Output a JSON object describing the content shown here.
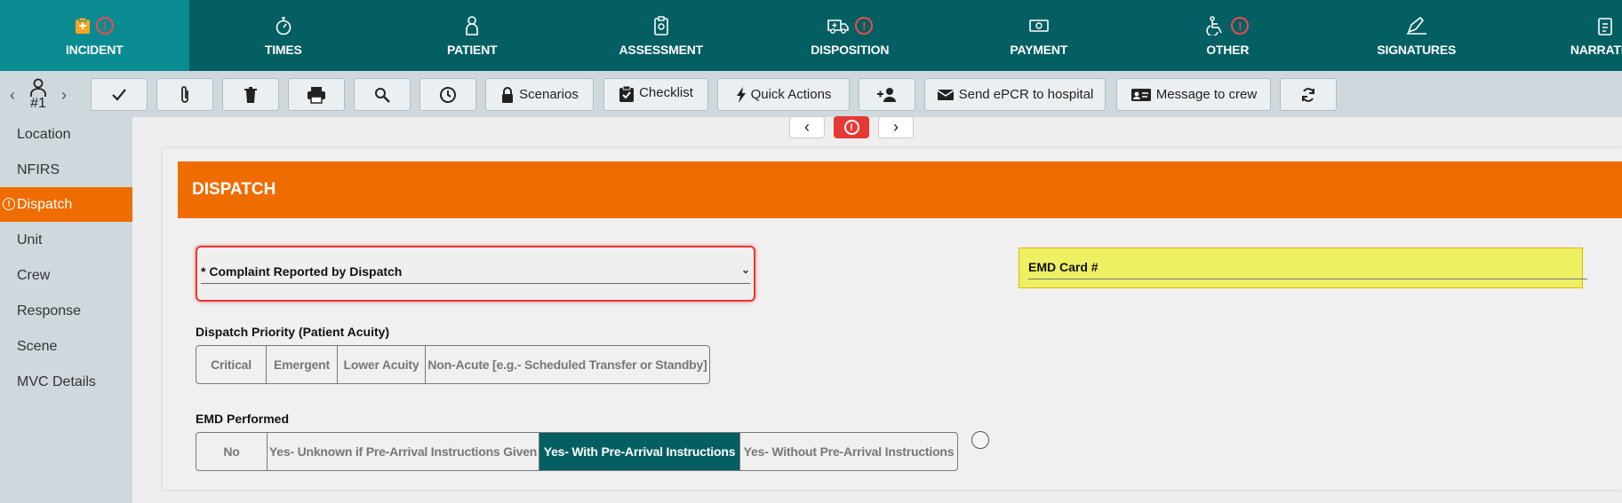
{
  "nav_tabs": [
    {
      "label": "INCIDENT",
      "icon": "clipboard-plus-icon",
      "alert": true,
      "active": true
    },
    {
      "label": "TIMES",
      "icon": "stopwatch-icon",
      "alert": false,
      "active": false
    },
    {
      "label": "PATIENT",
      "icon": "person-icon",
      "alert": false,
      "active": false
    },
    {
      "label": "ASSESSMENT",
      "icon": "clipboard-check-icon",
      "alert": false,
      "active": false
    },
    {
      "label": "DISPOSITION",
      "icon": "ambulance-icon",
      "alert": true,
      "active": false
    },
    {
      "label": "PAYMENT",
      "icon": "money-icon",
      "alert": false,
      "active": false
    },
    {
      "label": "OTHER",
      "icon": "wheelchair-icon",
      "alert": true,
      "active": false
    },
    {
      "label": "SIGNATURES",
      "icon": "signature-icon",
      "alert": false,
      "active": false
    },
    {
      "label": "NARRATIVE",
      "icon": "document-icon",
      "alert": false,
      "active": false
    }
  ],
  "alert_glyph": "!",
  "patient_nav": {
    "number": "#1",
    "prev": "‹",
    "next": "›"
  },
  "toolbar": {
    "scenarios": "Scenarios",
    "checklist": "Checklist",
    "quick_actions": "Quick Actions",
    "send_epcr": "Send ePCR to hospital",
    "message_crew": "Message to crew"
  },
  "sidebar": {
    "items": [
      "Location",
      "NFIRS",
      "Dispatch",
      "Unit",
      "Crew",
      "Response",
      "Scene",
      "MVC Details"
    ],
    "active_index": 2
  },
  "pager": {
    "prev": "‹",
    "next": "›"
  },
  "section": {
    "title": "DISPATCH",
    "complaint_label": "* Complaint Reported by Dispatch",
    "complaint_caret": "⌄",
    "emd_card_label": "EMD Card #",
    "priority_label": "Dispatch Priority (Patient Acuity)",
    "priority_options": [
      "Critical",
      "Emergent",
      "Lower Acuity",
      "Non-Acute [e.g.- Scheduled Transfer or Standby]"
    ],
    "emd_performed_label": "EMD Performed",
    "emd_options": [
      "No",
      "Yes- Unknown if Pre-Arrival Instructions Given",
      "Yes- With Pre-Arrival Instructions",
      "Yes- Without Pre-Arrival Instructions"
    ],
    "emd_selected_index": 2
  },
  "colors": {
    "nav_bg": "#045f63",
    "nav_active": "#0a8b92",
    "orange": "#ef6c00",
    "alert_red": "#e53935",
    "highlight_yellow": "#eef063"
  }
}
